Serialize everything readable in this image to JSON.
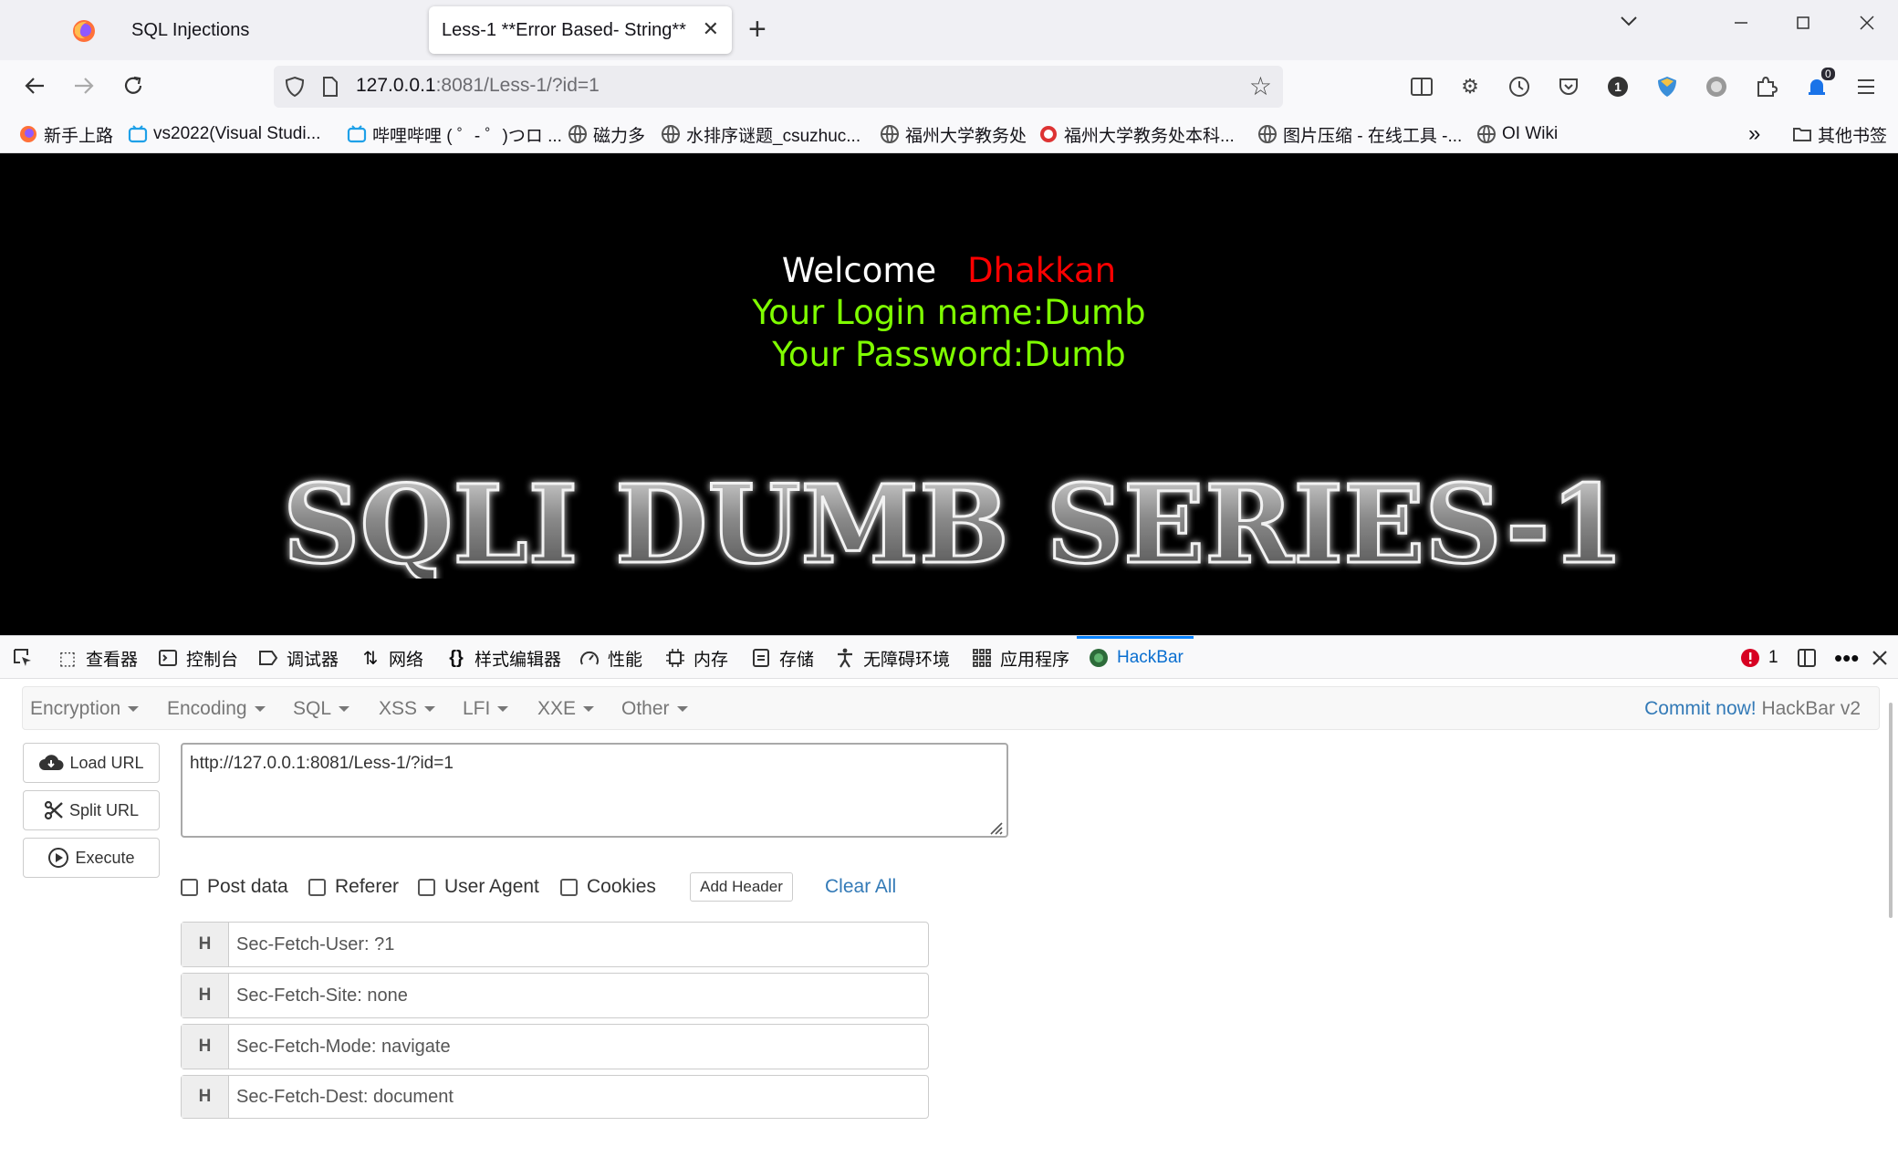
{
  "tabs": [
    {
      "title": "SQL Injections"
    },
    {
      "title": "Less-1 **Error Based- String**"
    }
  ],
  "address": {
    "host": "127.0.0.1",
    "rest": ":8081/Less-1/?id=1"
  },
  "extensions": {
    "badge_count": "1",
    "notif_count": "0"
  },
  "bookmarks": [
    "新手上路",
    "vs2022(Visual Studi...",
    "哔哩哔哩 ( ゜- ゜)つロ ...",
    "磁力多",
    "水排序谜题_csuzhuc...",
    "福州大学教务处",
    "福州大学教务处本科...",
    "图片压缩 - 在线工具 -...",
    "OI Wiki"
  ],
  "bookmarks_other": "其他书签",
  "page": {
    "welcome": "Welcome",
    "name": "Dhakkan",
    "login": "Your Login name:Dumb",
    "password": "Your Password:Dumb",
    "logo_text": "SQLI DUMB SERIES-1"
  },
  "devtools": {
    "tabs": [
      "查看器",
      "控制台",
      "调试器",
      "网络",
      "样式编辑器",
      "性能",
      "内存",
      "存储",
      "无障碍环境",
      "应用程序",
      "HackBar"
    ],
    "error_count": "1"
  },
  "hackbar": {
    "menu": [
      "Encryption",
      "Encoding",
      "SQL",
      "XSS",
      "LFI",
      "XXE",
      "Other"
    ],
    "commit_link": "Commit now!",
    "commit_tail": " HackBar v2",
    "load_url": "Load URL",
    "split_url": "Split URL",
    "execute": "Execute",
    "url_value": "http://127.0.0.1:8081/Less-1/?id=1",
    "options": [
      "Post data",
      "Referer",
      "User Agent",
      "Cookies"
    ],
    "add_header": "Add Header",
    "clear_all": "Clear All",
    "header_tag": "H",
    "headers": [
      "Sec-Fetch-User: ?1",
      "Sec-Fetch-Site: none",
      "Sec-Fetch-Mode: navigate",
      "Sec-Fetch-Dest: document"
    ]
  },
  "colors": {
    "welcome_name": "#ff0000",
    "welcome_text": "#7fff00",
    "link": "#337ab7"
  }
}
